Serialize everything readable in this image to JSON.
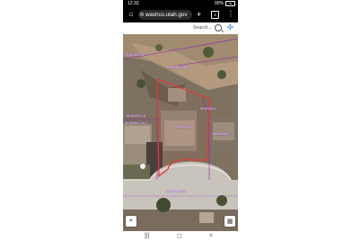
{
  "status": {
    "time": "12:33",
    "notif_icons": "♥ ◆ dk •",
    "signal": "90%",
    "battery": "49"
  },
  "browser": {
    "url": "washco.utah.gov",
    "new_tab": "+",
    "tab_count": "4",
    "menu": "⋮"
  },
  "search": {
    "placeholder": "Search..."
  },
  "map": {
    "labels": {
      "top_left": "S-0000-0-0",
      "top_center": "W-0000-0-000",
      "left_mid": "W-0000-0-0",
      "left_lower": "W-0000-0-0-0",
      "parcel": "W-0000-0",
      "right_upper": "W-0000-0",
      "right_lower": "W-0000-0",
      "street": "W 0TH N 00"
    },
    "parcel_outline_color": "#e53935"
  },
  "nav": {
    "recents": "|||",
    "home": "◻",
    "back": "<"
  }
}
